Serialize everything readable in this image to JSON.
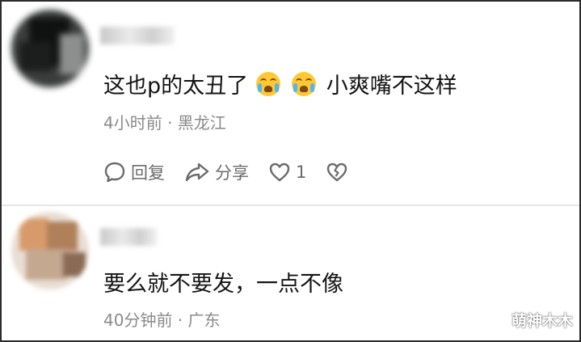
{
  "comments": [
    {
      "text_before": "这也p的太丑了",
      "emoji_1": "crying-face-emoji",
      "emoji_2": "crying-face-emoji",
      "text_after": "小爽嘴不这样",
      "meta": "4小时前 · 黑龙江",
      "actions": {
        "reply": "回复",
        "share": "分享",
        "like_count": "1"
      }
    },
    {
      "text": "要么就不要发，一点不像",
      "meta": "40分钟前 · 广东"
    }
  ],
  "watermark": "萌神木木",
  "colors": {
    "text": "#141414",
    "meta": "#8a8a8a",
    "icon": "#6b6b6b",
    "emoji": "#ffc833"
  }
}
